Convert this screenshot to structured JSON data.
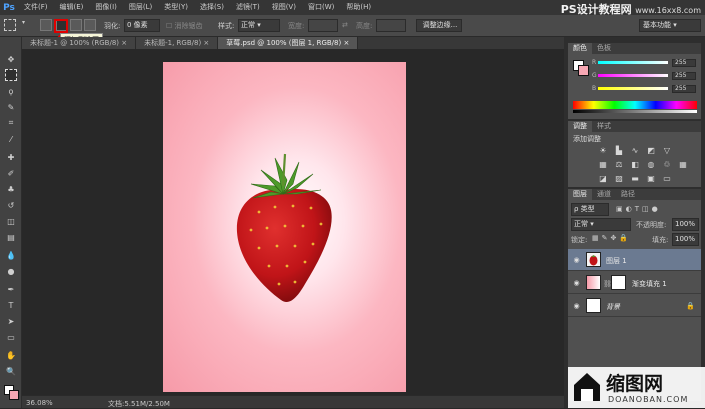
{
  "app": {
    "logo": "Ps"
  },
  "menu": [
    "文件(F)",
    "编辑(E)",
    "图像(I)",
    "图层(L)",
    "类型(Y)",
    "选择(S)",
    "滤镜(T)",
    "视图(V)",
    "窗口(W)",
    "帮助(H)"
  ],
  "watermark_top": {
    "main": "PS设计教程网",
    "sub": "www.16xx8.com"
  },
  "options": {
    "feather_label": "羽化:",
    "feather_value": "0 像素",
    "antialias_label": "消除锯齿",
    "style_label": "样式:",
    "style_value": "正常",
    "width_label": "宽度:",
    "height_label": "高度:",
    "refine_button": "调整边缘...",
    "workspace": "基本功能"
  },
  "tooltip": "添加到选区",
  "tabs": [
    {
      "label": "未标题-1 @ 100% (RGB/8) ×",
      "active": false
    },
    {
      "label": "未标题-1, RGB/8) ×",
      "active": false
    },
    {
      "label": "草莓.psd @ 100% (图层 1, RGB/8) ×",
      "active": true
    }
  ],
  "status": {
    "zoom": "36.08%",
    "doc": "文档:5.51M/2.50M"
  },
  "color_panel": {
    "tabs": [
      "颜色",
      "色板"
    ],
    "r": "255",
    "g": "255",
    "b": "255",
    "r_label": "R",
    "g_label": "G",
    "b_label": "B"
  },
  "adjust_panel": {
    "tabs": [
      "调整",
      "样式"
    ],
    "title": "添加调整"
  },
  "layers_panel": {
    "tabs": [
      "图层",
      "通道",
      "路径"
    ],
    "kind_label": "ρ 类型",
    "blend_mode": "正常",
    "opacity_label": "不透明度:",
    "opacity_value": "100%",
    "lock_label": "锁定:",
    "fill_label": "填充:",
    "fill_value": "100%",
    "layers": [
      {
        "name": "图层 1",
        "selected": true
      },
      {
        "name": "渐变填充 1",
        "selected": false
      },
      {
        "name": "背景",
        "selected": false
      }
    ]
  },
  "watermark_bottom": {
    "brand": "缩图网",
    "sub": "DOANOBAN.COM"
  },
  "colors": {
    "accent_red": "#e00000",
    "selected_layer": "#6b7a91",
    "canvas_pink": "#f69aa8"
  }
}
